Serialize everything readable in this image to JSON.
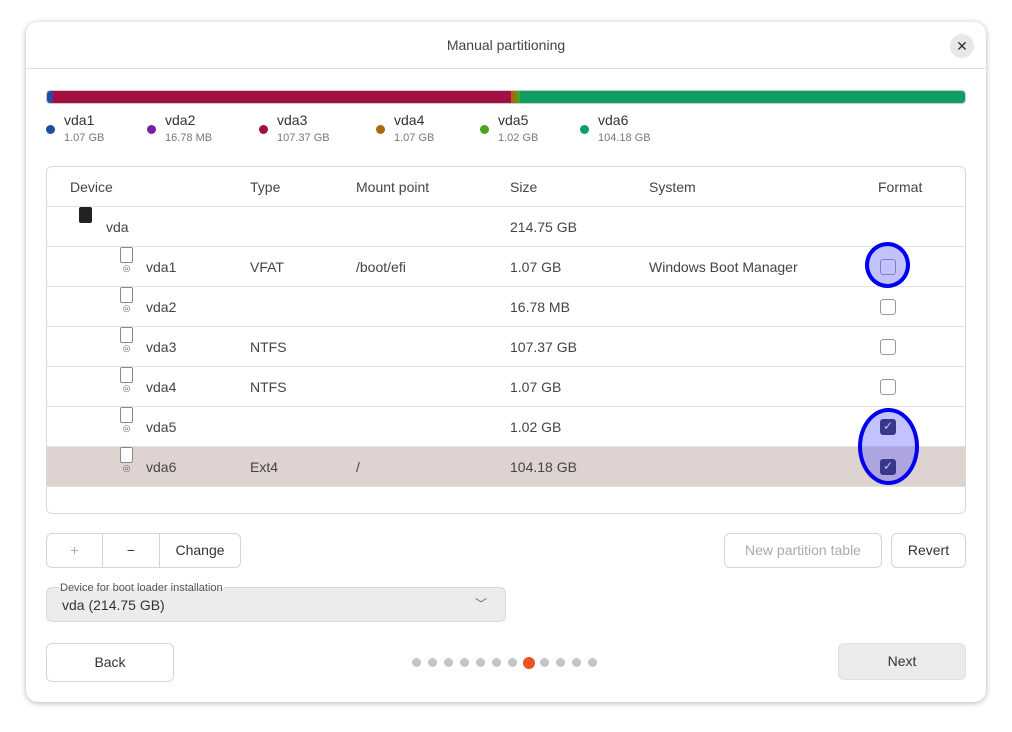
{
  "window": {
    "title": "Manual partitioning",
    "close_icon": "close-icon"
  },
  "partitions_bar": [
    {
      "name": "vda1",
      "size": "1.07 GB",
      "gb": 1.07,
      "color": "#1a4fa8"
    },
    {
      "name": "vda2",
      "size": "16.78 MB",
      "gb": 0.01678,
      "color": "#7a1fa2"
    },
    {
      "name": "vda3",
      "size": "107.37 GB",
      "gb": 107.37,
      "color": "#a20f42"
    },
    {
      "name": "vda4",
      "size": "1.07 GB",
      "gb": 1.07,
      "color": "#a86a10"
    },
    {
      "name": "vda5",
      "size": "1.02 GB",
      "gb": 1.02,
      "color": "#4aa318"
    },
    {
      "name": "vda6",
      "size": "104.18 GB",
      "gb": 104.18,
      "color": "#0f9e63"
    }
  ],
  "table": {
    "headers": {
      "device": "Device",
      "type": "Type",
      "mount": "Mount point",
      "size": "Size",
      "system": "System",
      "format": "Format"
    },
    "rows": [
      {
        "device": "vda",
        "type": "",
        "mount": "",
        "size": "214.75 GB",
        "system": "",
        "format": null,
        "level": 0
      },
      {
        "device": "vda1",
        "type": "VFAT",
        "mount": "/boot/efi",
        "size": "1.07 GB",
        "system": "Windows Boot Manager",
        "format": false,
        "level": 1
      },
      {
        "device": "vda2",
        "type": "",
        "mount": "",
        "size": "16.78 MB",
        "system": "",
        "format": false,
        "level": 1
      },
      {
        "device": "vda3",
        "type": "NTFS",
        "mount": "",
        "size": "107.37 GB",
        "system": "",
        "format": false,
        "level": 1
      },
      {
        "device": "vda4",
        "type": "NTFS",
        "mount": "",
        "size": "1.07 GB",
        "system": "",
        "format": false,
        "level": 1
      },
      {
        "device": "vda5",
        "type": "",
        "mount": "",
        "size": "1.02 GB",
        "system": "",
        "format": true,
        "level": 1
      },
      {
        "device": "vda6",
        "type": "Ext4",
        "mount": "/",
        "size": "104.18 GB",
        "system": "",
        "format": true,
        "level": 1,
        "selected": true
      }
    ]
  },
  "toolbar": {
    "add": "+",
    "remove": "−",
    "change": "Change",
    "new_table": "New partition table",
    "revert": "Revert"
  },
  "bootloader": {
    "label": "Device for boot loader installation",
    "value": "vda  (214.75 GB)"
  },
  "footer": {
    "back": "Back",
    "next": "Next",
    "pages": 12,
    "current_page": 8,
    "accent": "#e95420"
  }
}
